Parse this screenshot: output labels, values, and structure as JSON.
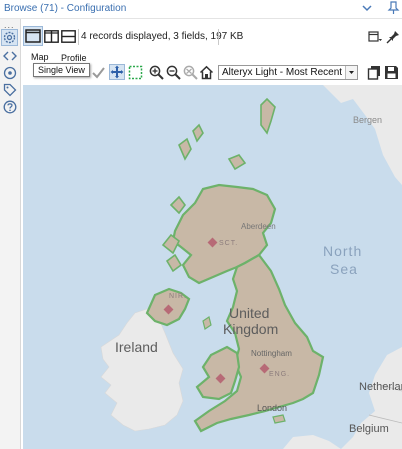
{
  "window": {
    "title": "Browse (71) - Configuration"
  },
  "leftbar": {
    "dots": "..."
  },
  "toolbar": {
    "records_info": "4 records displayed, 3 fields, 197 KB",
    "view_tabs": [
      "Map",
      "Profile"
    ],
    "tooltip": "Single View"
  },
  "map_toolbar": {
    "basemap_selected": "Alteryx Light - Most Recent Vintage"
  },
  "map": {
    "labels": {
      "uk1": "United",
      "uk2": "Kingdom",
      "ireland": "Ireland",
      "north_sea_1": "North",
      "north_sea_2": "Sea",
      "aberdeen": "Aberdeen",
      "nottingham": "Nottingham",
      "london": "London",
      "eng": "ENG.",
      "sct": "SCT.",
      "nir": "NIR.",
      "netherlands": "Netherlan",
      "belgium": "Belgium",
      "bergen": "Bergen"
    },
    "colors": {
      "sea": "#c9dcec",
      "land": "#eaeaea",
      "region_fill": "#c8b8a6",
      "region_stroke": "#6db26a",
      "marker": "#b76a76"
    }
  }
}
